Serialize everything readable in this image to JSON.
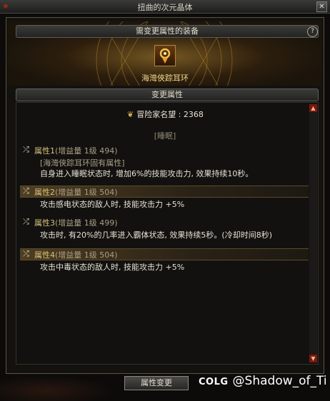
{
  "window": {
    "title": "扭曲的次元晶体",
    "close_glyph": "✕"
  },
  "equipment_section": {
    "title": "需变更属性的装备",
    "help_glyph": "?"
  },
  "item": {
    "name": "海灣俠踪耳环",
    "icon": "earring-icon"
  },
  "change_section": {
    "title": "变更属性"
  },
  "fame": {
    "label": "冒险家名望 : 2368",
    "icon": "fame-icon"
  },
  "tag": "[睡眠]",
  "attributes": [
    {
      "name": "属性1",
      "gain": "(增益量 1级 494)",
      "lines": [
        "[海灣俠踪耳环固有属性]",
        "自身进入睡眠状态时, 增加6%的技能攻击力, 效果持续10秒。"
      ]
    },
    {
      "name": "属性2",
      "gain": "(增益量 1级 504)",
      "lines": [
        "攻击感电状态的敌人时, 技能攻击力 +5%"
      ]
    },
    {
      "name": "属性3",
      "gain": "(增益量 1级 499)",
      "lines": [
        "攻击时, 有20%的几率进入霸体状态, 效果持续5秒。(冷却时间8秒)"
      ]
    },
    {
      "name": "属性4",
      "gain": "(增益量 1级 504)",
      "lines": [
        "攻击中毒状态的敌人时, 技能攻击力 +5%"
      ]
    }
  ],
  "scroll": {
    "up": "▲",
    "down": "▼"
  },
  "button": {
    "label": "属性变更"
  },
  "watermark": {
    "brand": "COLG",
    "handle": "@Shadow_of_Ti"
  },
  "colors": {
    "accent_gold": "#d9c27a",
    "highlight_row": "#4e3e22",
    "scroll_red": "#7a1810"
  }
}
